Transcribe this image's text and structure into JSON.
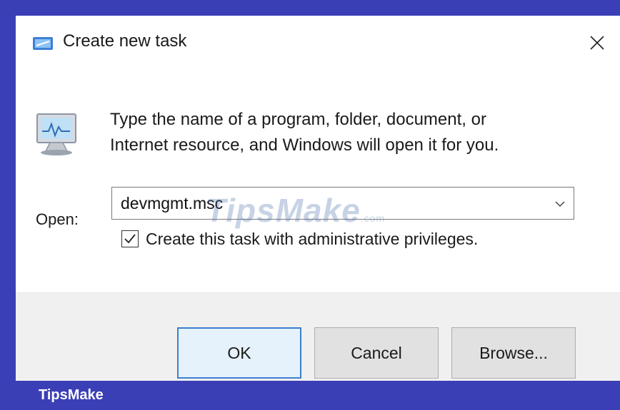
{
  "window": {
    "title": "Create new task",
    "title_icon": "run-dialog-icon",
    "close_icon": "close-icon"
  },
  "message": {
    "line1": "Type the name of a program, folder, document, or",
    "line2": "Internet resource, and Windows will open it for you."
  },
  "form": {
    "open_label": "Open:",
    "open_value": "devmgmt.msc",
    "admin_checkbox_label": "Create this task with administrative privileges.",
    "admin_checked": true
  },
  "buttons": {
    "ok": "OK",
    "cancel": "Cancel",
    "browse": "Browse..."
  },
  "watermark": "TipsMake",
  "watermark_small": ".com",
  "brand": "TipsMake",
  "colors": {
    "frame": "#3B3FB6",
    "ok_border": "#3D7FD1",
    "footer": "#F0F0F0"
  }
}
